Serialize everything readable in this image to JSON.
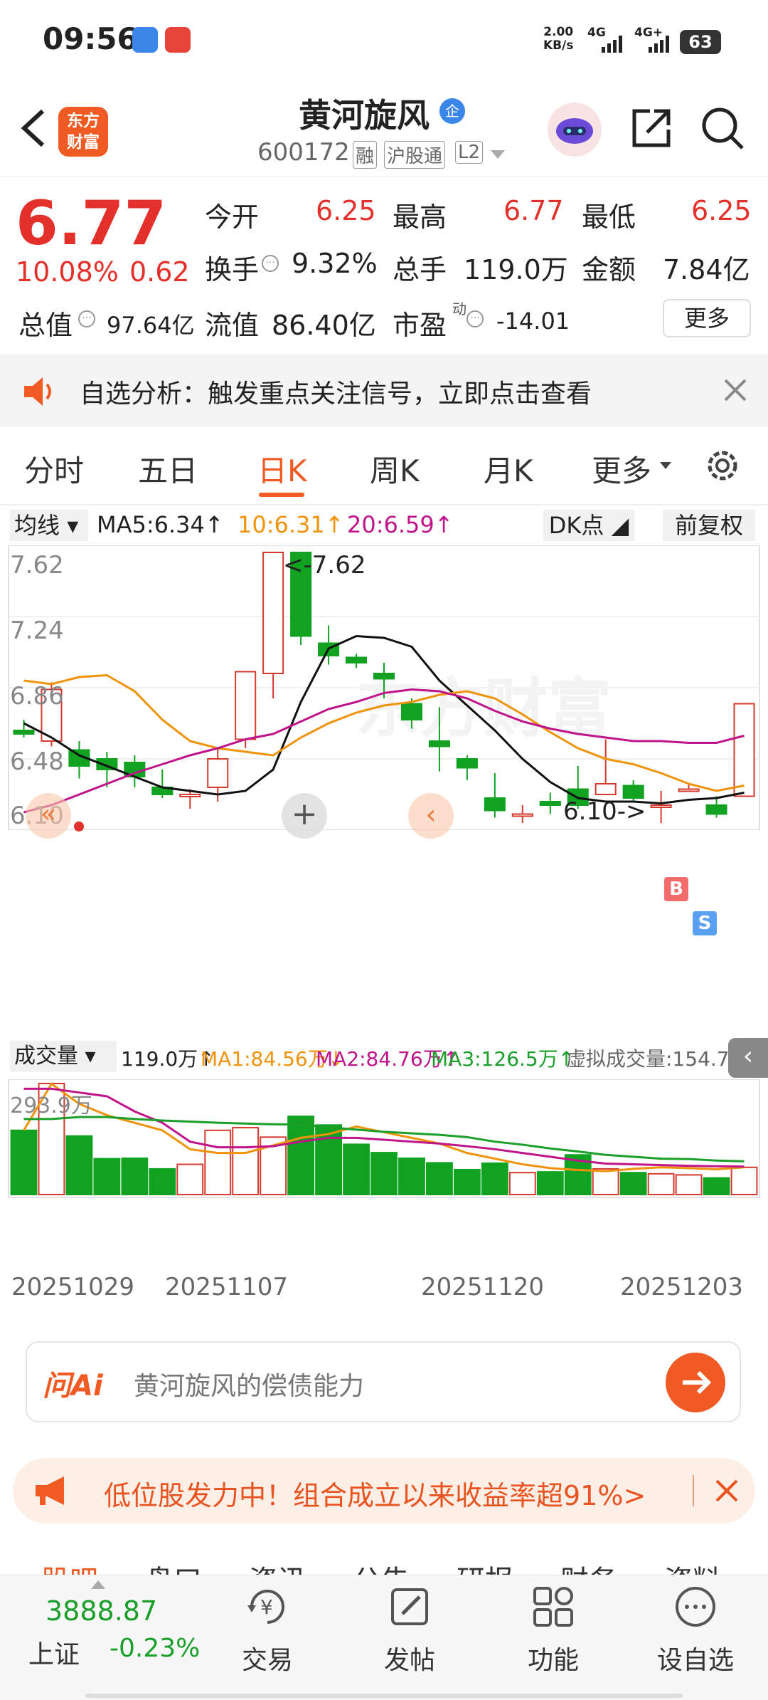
{
  "status": {
    "time": "09:56",
    "net_speed": "2.00",
    "net_unit": "KB/s",
    "net1": "4G",
    "net2": "4G+",
    "battery": "63"
  },
  "header": {
    "stock_name": "黄河旋风",
    "name_badge": "企",
    "code": "600172",
    "tags": [
      "融",
      "沪股通",
      "L2"
    ],
    "logo_line1": "东方",
    "logo_line2": "财富"
  },
  "quote": {
    "price": "6.77",
    "change_pct": "10.08%",
    "change_amt": "0.62",
    "open_label": "今开",
    "open": "6.25",
    "high_label": "最高",
    "high": "6.77",
    "low_label": "最低",
    "low": "6.25",
    "turnover_label": "换手",
    "turnover": "9.32%",
    "volume_label": "总手",
    "volume": "119.0万",
    "amount_label": "金额",
    "amount": "7.84亿",
    "mktcap_label": "总值",
    "mktcap": "97.64亿",
    "float_label": "流值",
    "float": "86.40亿",
    "pe_label": "市盈",
    "pe_sup": "动",
    "pe": "-14.01",
    "more_button": "更多"
  },
  "banner": {
    "text": "自选分析：触发重点关注信号，立即点击查看"
  },
  "tabs": [
    "分时",
    "五日",
    "日K",
    "周K",
    "月K",
    "更多"
  ],
  "active_tab": "日K",
  "ma_bar": {
    "ma_select": "均线",
    "ma5": "MA5:6.34",
    "ma10": "10:6.31",
    "ma20": "20:6.59",
    "dk_button": "DK点",
    "fq_button": "前复权"
  },
  "kline": {
    "y_labels": [
      "7.62",
      "7.24",
      "6.86",
      "6.48",
      "6.10"
    ],
    "max_label": "<-7.62",
    "min_label": "6.10->",
    "b_marker": "B",
    "s_marker": "S",
    "watermark": "东方财富"
  },
  "vol_bar": {
    "select": "成交量",
    "vol": "119.0万",
    "ma1": "MA1:84.56万",
    "ma2": "MA2:84.76万",
    "ma3": "MA3:126.5万",
    "virtual": "虚拟成交量:154.7万"
  },
  "volume": {
    "max_label": "293.9万"
  },
  "dates": [
    "20251029",
    "20251107",
    "20251120",
    "20251203"
  ],
  "ai": {
    "logo": "问Ai",
    "placeholder": "黄河旋风的偿债能力"
  },
  "promo": {
    "text": "低位股发力中！组合成立以来收益率超91%>"
  },
  "subtabs": [
    "股吧",
    "盘口",
    "资讯",
    "公告",
    "研报",
    "财务",
    "资料"
  ],
  "bottom": {
    "index_value": "3888.87",
    "index_name": "上证",
    "index_change": "-0.23%",
    "items": [
      "交易",
      "发帖",
      "功能",
      "设自选"
    ]
  },
  "chart_data": {
    "type": "candlestick",
    "title": "",
    "x": [
      1,
      2,
      3,
      4,
      5,
      6,
      7,
      8,
      9,
      10,
      11,
      12,
      13,
      14,
      15,
      16,
      17,
      18,
      19,
      20,
      21,
      22,
      23,
      24,
      25,
      26
    ],
    "ohlc": [
      [
        6.62,
        6.6,
        6.68,
        6.58
      ],
      [
        6.56,
        6.85,
        6.89,
        6.53
      ],
      [
        6.51,
        6.42,
        6.56,
        6.35
      ],
      [
        6.46,
        6.4,
        6.5,
        6.3
      ],
      [
        6.44,
        6.36,
        6.48,
        6.3
      ],
      [
        6.3,
        6.26,
        6.4,
        6.24
      ],
      [
        6.25,
        6.26,
        6.29,
        6.18
      ],
      [
        6.3,
        6.46,
        6.52,
        6.22
      ],
      [
        6.57,
        6.95,
        6.95,
        6.52
      ],
      [
        6.94,
        7.62,
        7.62,
        6.8
      ],
      [
        7.62,
        7.15,
        7.62,
        7.1
      ],
      [
        7.11,
        7.04,
        7.21,
        6.99
      ],
      [
        7.03,
        7.0,
        7.05,
        6.97
      ],
      [
        6.94,
        6.91,
        7.0,
        6.8
      ],
      [
        6.77,
        6.68,
        6.8,
        6.63
      ],
      [
        6.56,
        6.53,
        6.75,
        6.39
      ],
      [
        6.46,
        6.41,
        6.48,
        6.34
      ],
      [
        6.24,
        6.17,
        6.38,
        6.13
      ],
      [
        6.15,
        6.15,
        6.2,
        6.1
      ],
      [
        6.22,
        6.2,
        6.27,
        6.15
      ],
      [
        6.29,
        6.2,
        6.42,
        6.18
      ],
      [
        6.26,
        6.32,
        6.57,
        6.26
      ],
      [
        6.31,
        6.24,
        6.34,
        6.22
      ],
      [
        6.2,
        6.2,
        6.28,
        6.1
      ],
      [
        6.29,
        6.29,
        6.32,
        6.28
      ],
      [
        6.2,
        6.15,
        6.25,
        6.13
      ],
      [
        6.25,
        6.77,
        6.77,
        6.25
      ]
    ],
    "ma5": [
      6.66,
      6.58,
      6.48,
      6.42,
      6.36,
      6.3,
      6.28,
      6.26,
      6.28,
      6.4,
      6.78,
      7.08,
      7.15,
      7.14,
      7.09,
      6.9,
      6.76,
      6.62,
      6.46,
      6.33,
      6.24,
      6.22,
      6.22,
      6.21,
      6.23,
      6.24,
      6.27
    ],
    "ma10": [
      6.9,
      6.88,
      6.92,
      6.93,
      6.84,
      6.68,
      6.56,
      6.52,
      6.5,
      6.48,
      6.58,
      6.66,
      6.72,
      6.76,
      6.78,
      6.82,
      6.84,
      6.8,
      6.71,
      6.61,
      6.52,
      6.46,
      6.43,
      6.38,
      6.32,
      6.28,
      6.31
    ],
    "ma20": [
      6.16,
      6.2,
      6.26,
      6.32,
      6.38,
      6.43,
      6.48,
      6.52,
      6.57,
      6.6,
      6.67,
      6.74,
      6.78,
      6.83,
      6.85,
      6.84,
      6.8,
      6.73,
      6.67,
      6.63,
      6.6,
      6.58,
      6.56,
      6.56,
      6.55,
      6.55,
      6.59
    ],
    "volumes": [
      170,
      293.9,
      155,
      95,
      96,
      68,
      80,
      170,
      177,
      152,
      207,
      184,
      133,
      111,
      96,
      84,
      66,
      83,
      58,
      60,
      105,
      68,
      58,
      55,
      52,
      44,
      72
    ],
    "vol_ma1": [
      170,
      293,
      240,
      210,
      190,
      170,
      120,
      110,
      110,
      130,
      150,
      160,
      180,
      165,
      150,
      135,
      110,
      95,
      80,
      70,
      65,
      62,
      68,
      72,
      70,
      67,
      72
    ],
    "vol_ma2": [
      280,
      280,
      270,
      260,
      220,
      190,
      140,
      125,
      125,
      128,
      140,
      150,
      150,
      145,
      140,
      135,
      128,
      120,
      110,
      100,
      90,
      82,
      80,
      78,
      76,
      75,
      74
    ],
    "vol_ma3": [
      200,
      200,
      205,
      205,
      200,
      196,
      193,
      190,
      188,
      186,
      185,
      178,
      172,
      166,
      162,
      158,
      152,
      140,
      132,
      122,
      114,
      105,
      100,
      95,
      94,
      90,
      88
    ],
    "ylim": [
      6.1,
      7.62
    ],
    "vol_ylim": [
      0,
      293.9
    ]
  }
}
